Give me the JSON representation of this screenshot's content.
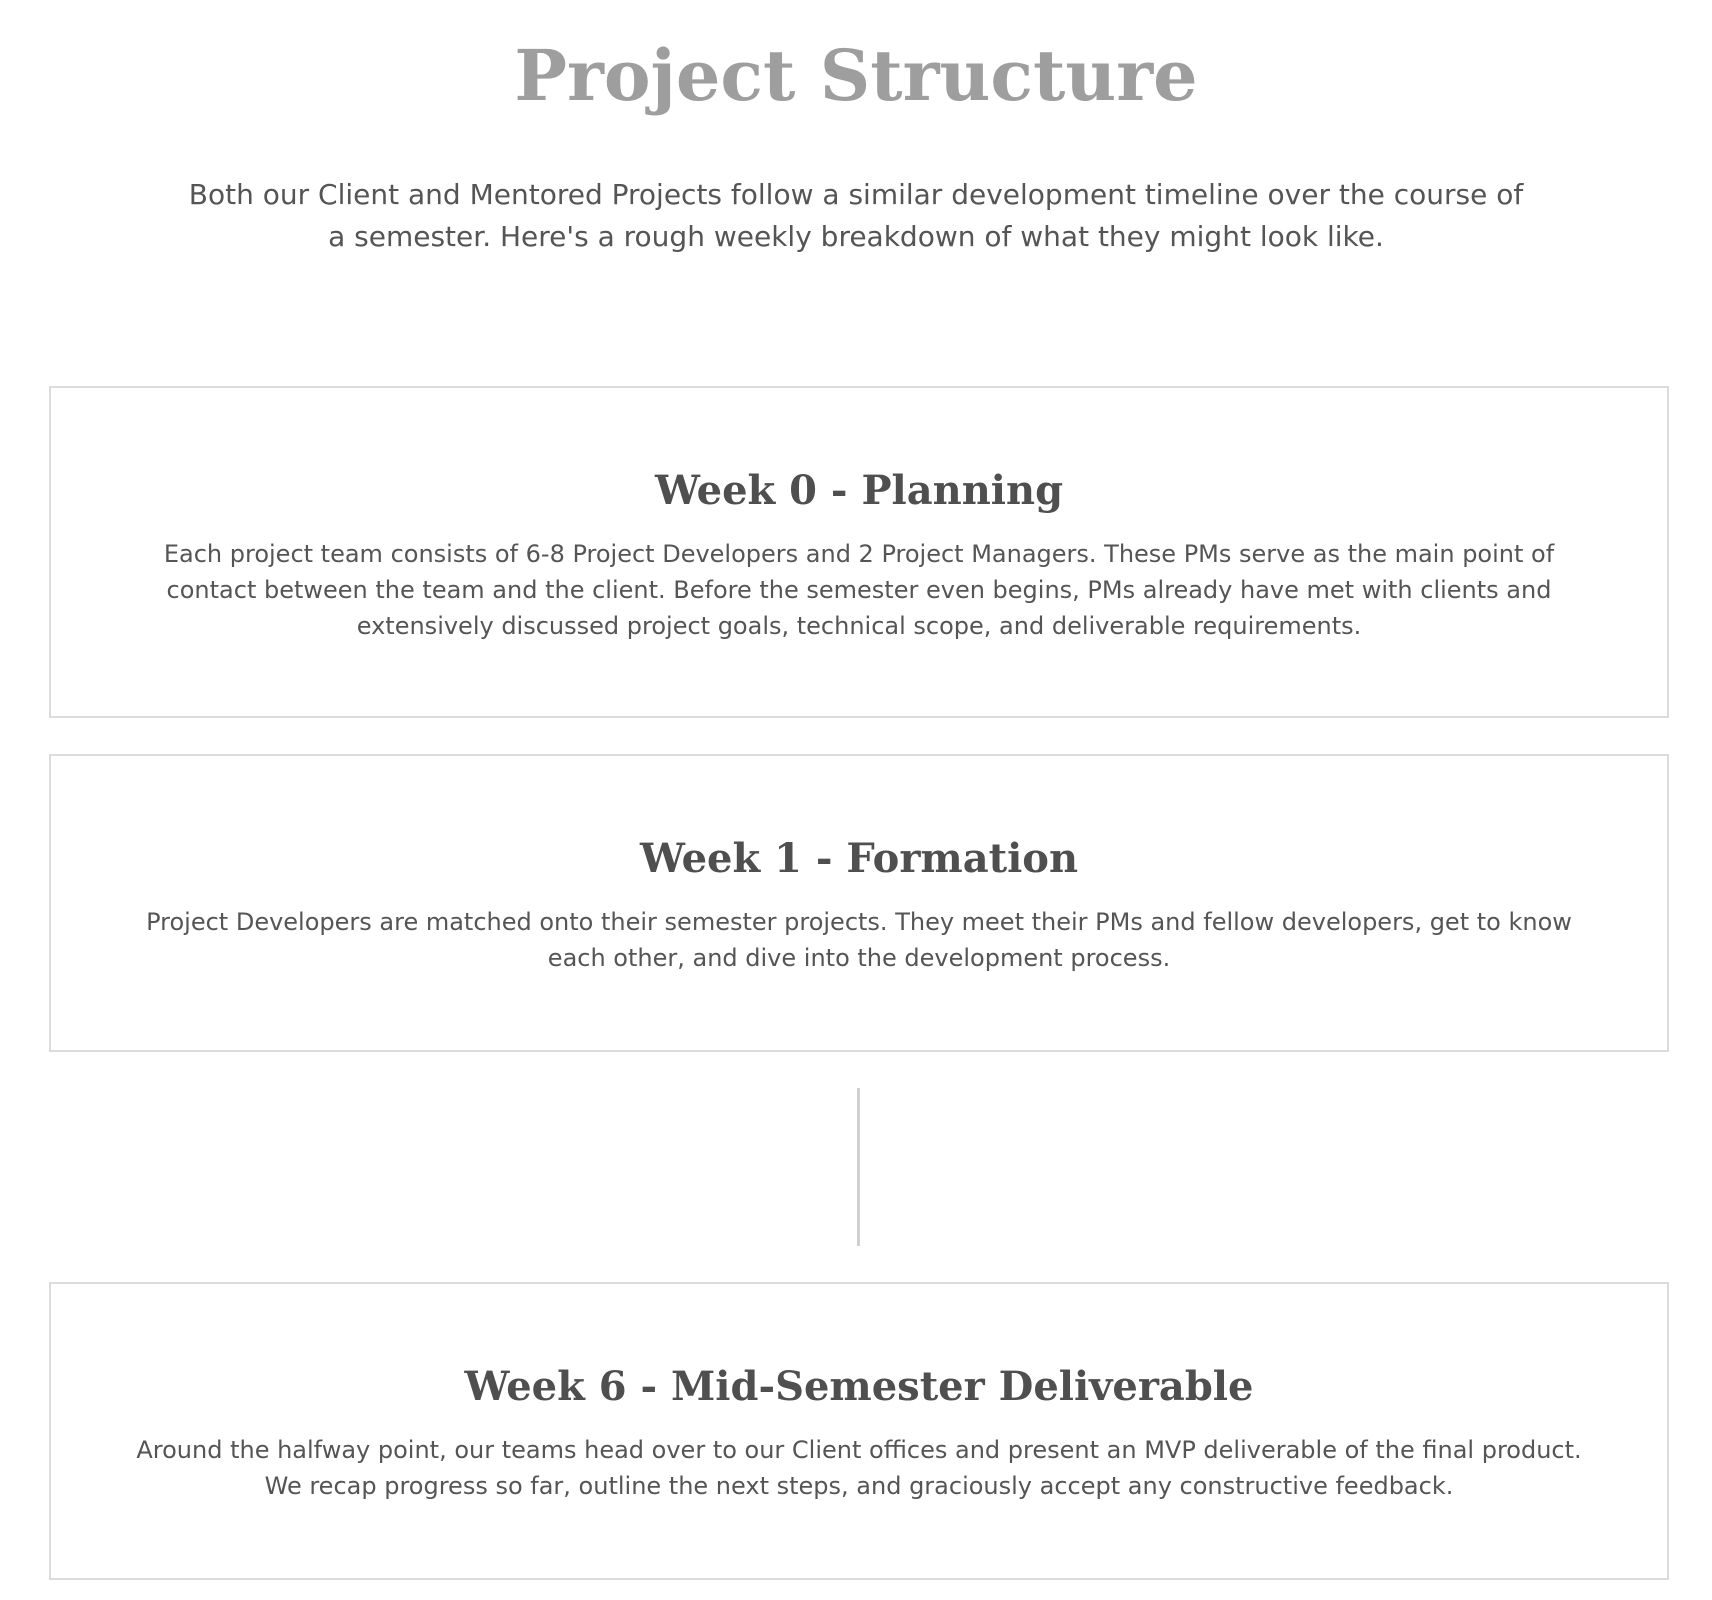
{
  "header": {
    "title": "Project Structure",
    "intro": "Both our Client and Mentored Projects follow a similar development timeline over the course of a semester. Here's a rough weekly breakdown of what they might look like."
  },
  "timeline": {
    "items": [
      {
        "title": "Week 0 - Planning",
        "body": "Each project team consists of 6-8 Project Developers and 2 Project Managers. These PMs serve as the main point of contact between the team and the client. Before the semester even begins, PMs already have met with clients and extensively discussed project goals, technical scope, and deliverable requirements."
      },
      {
        "title": "Week 1 - Formation",
        "body": "Project Developers are matched onto their semester projects. They meet their PMs and fellow developers, get to know each other, and dive into the development process."
      },
      {
        "title": "Week 6 - Mid-Semester Deliverable",
        "body": "Around the halfway point, our teams head over to our Client offices and present an MVP deliverable of the final product. We recap progress so far, outline the next steps, and graciously accept any constructive feedback."
      }
    ]
  }
}
